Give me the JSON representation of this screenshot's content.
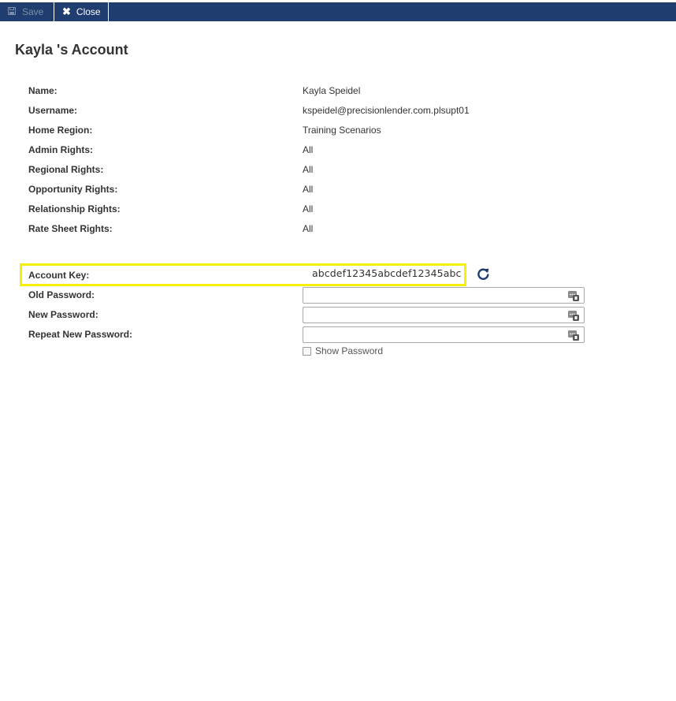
{
  "toolbar": {
    "save_label": "Save",
    "close_label": "Close"
  },
  "page": {
    "title": "Kayla 's Account"
  },
  "fields": [
    {
      "label": "Name:",
      "value": "Kayla Speidel"
    },
    {
      "label": "Username:",
      "value": "kspeidel@precisionlender.com.plsupt01"
    },
    {
      "label": "Home Region:",
      "value": "Training Scenarios"
    },
    {
      "label": "Admin Rights:",
      "value": "All"
    },
    {
      "label": "Regional Rights:",
      "value": "All"
    },
    {
      "label": "Opportunity Rights:",
      "value": "All"
    },
    {
      "label": "Relationship Rights:",
      "value": "All"
    },
    {
      "label": "Rate Sheet Rights:",
      "value": "All"
    }
  ],
  "account_key": {
    "label": "Account Key:",
    "value": "abcdef12345abcdef12345abc",
    "highlight_color": "#f5f000"
  },
  "password": {
    "old_label": "Old Password:",
    "old_value": "",
    "new_label": "New Password:",
    "new_value": "",
    "repeat_label": "Repeat New Password:",
    "repeat_value": "",
    "show_label": "Show Password",
    "show_checked": false
  },
  "icons": {
    "save": "save-icon",
    "close": "close-icon",
    "refresh": "refresh-icon",
    "password": "password-manager-icon"
  },
  "colors": {
    "toolbar_bg": "#1f3d6f",
    "refresh": "#1f3d6f"
  }
}
